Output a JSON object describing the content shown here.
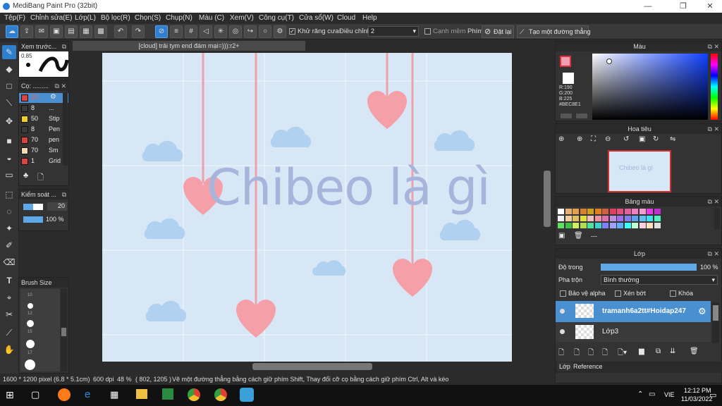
{
  "window": {
    "title": "MediBang Paint Pro (32bit)"
  },
  "menu": [
    "Tệp(F)",
    "Chỉnh sửa(E)",
    "Lớp(L)",
    "Bộ lọc(R)",
    "Chọn(S)",
    "Chụp(N)",
    "Màu (C)",
    "Xem(V)",
    "Công cụ(T)",
    "Cửa sổ(W)",
    "Cloud",
    "Help"
  ],
  "toolbar": {
    "antialias": "Khử răng cưa",
    "adjust_label": "Điều chỉnh",
    "adjust_value": "2",
    "edge": "Cạnh mềm",
    "snap_label": "Phím",
    "reset": "Đặt lại",
    "straight": "Tạo một đường thẳng"
  },
  "doc_tab": "[cloud] trải tym end đám mại=))):r2+",
  "preview": {
    "title": "Xem trước...",
    "value": "0.85"
  },
  "brush": {
    "title": "Cọ: .........",
    "items": [
      {
        "size": "20",
        "name": "",
        "active": true,
        "color": "#e04040"
      },
      {
        "size": "8",
        "name": "...",
        "color": "#3a3a3a"
      },
      {
        "size": "50",
        "name": "Stip",
        "color": "#f0d020"
      },
      {
        "size": "8",
        "name": "Pen",
        "color": "#3a3a3a"
      },
      {
        "size": "70",
        "name": "pen",
        "color": "#e04040"
      },
      {
        "size": "70",
        "name": "Sm",
        "color": "#f5d7b0"
      },
      {
        "size": "1",
        "name": "Grid",
        "color": "#e04040"
      }
    ]
  },
  "control": {
    "title": "Kiểm soát ...",
    "size": "20",
    "opacity": "100 %"
  },
  "brushsize": {
    "title": "Brush Size",
    "labels": [
      "10",
      "12",
      "15",
      "17"
    ]
  },
  "canvas_text": "Chibeo là gì",
  "color": {
    "title": "Màu",
    "r": "R:190",
    "g": "G:200",
    "b": "B:225",
    "hex": "#BEC8E1",
    "primary": "#BEC8E1"
  },
  "navigator": {
    "title": "Hoa tiêu"
  },
  "palette": {
    "title": "Bảng màu",
    "more": "---",
    "colors": [
      "#ffffff",
      "#e8b070",
      "#e0a050",
      "#d88030",
      "#d0a020",
      "#e08020",
      "#d06040",
      "#e04060",
      "#e05080",
      "#e060a0",
      "#f080c0",
      "#f0a0d0",
      "#e040e0",
      "#c030d0",
      "#f0f0f0",
      "#f0d0a0",
      "#e0c060",
      "#e0e040",
      "#f0c0c0",
      "#f090a0",
      "#e070b0",
      "#c090e0",
      "#a070f0",
      "#8080f0",
      "#60a0f0",
      "#60c0f0",
      "#40e0f0",
      "#50f0c0",
      "#60e060",
      "#40c040",
      "#d0f060",
      "#b0e050",
      "#50e0a0",
      "#40d0d0",
      "#8080ff",
      "#a0a0ff",
      "#60b0ff",
      "#40ffff",
      "#c0ffd0",
      "#ffd0e0",
      "#ffe0c0",
      "#e0e0e0"
    ]
  },
  "layers": {
    "title": "Lớp",
    "opacity_label": "Độ trong",
    "opacity_value": "100 %",
    "blend_label": "Pha trộn",
    "blend_value": "Bình thường",
    "protect_alpha": "Bảo vệ alpha",
    "clipping": "Xén bớt",
    "lock": "Khóa",
    "items": [
      {
        "name": "tramanh6a2tt#Hoidap247",
        "active": true
      },
      {
        "name": "Lớp3",
        "active": false
      }
    ],
    "tab_layer": "Lớp",
    "tab_reference": "Reference"
  },
  "status": {
    "size": "1600 * 1200 pixel",
    "cm": "(6.8 * 5.1cm)",
    "dpi": "600 dpi",
    "zoom": "48 %",
    "coords": "( 802, 1205 )",
    "hint": "Vẽ một đường thẳng bằng cách giữ phím Shift, Thay đổi cỡ cọ bằng cách giữ phím Ctrl, Alt và kéo"
  },
  "taskbar": {
    "lang": "VIE",
    "time": "12:12 PM",
    "date": "11/03/2022"
  }
}
